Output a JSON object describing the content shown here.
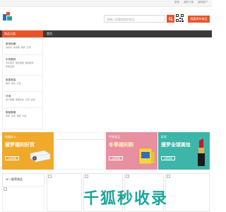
{
  "topbar": {
    "links": [
      "登录",
      "我的订单",
      "我的账户"
    ]
  },
  "header": {
    "search_placeholder": "请输入您要搜索的商品",
    "publish_label": "我要发布商品"
  },
  "nav": {
    "category_label": "商品分类",
    "home_label": "首页"
  },
  "categories": [
    {
      "title": "家用电器",
      "items": "洗衣机  电冰箱  电视  空调"
    },
    {
      "title": "手机数码",
      "items": "手机通讯  摄影摄像  数码配件  智能设备"
    },
    {
      "title": "家居家装",
      "items": "厨具  家纺  灯具"
    },
    {
      "title": "日用",
      "items": "电子电器  美容彩妆  日用  衣物"
    },
    {
      "title": "服装鞋帽",
      "items": "男装  女装  童装  内衣"
    }
  ],
  "promos": [
    {
      "subtitle": "电脑办公",
      "title": "搜罗福利好货",
      "cta": "立即查看",
      "color": "#f0a92a"
    },
    {
      "subtitle": "",
      "title": "",
      "cta": "",
      "color": "#ffffff"
    },
    {
      "subtitle": "牛奶乳品",
      "title": "冬季福利购",
      "cta": "立即查看",
      "color": "#e88fa0"
    },
    {
      "subtitle": "彩妆",
      "title": "搜罗全球美妆",
      "cta": "立即查看",
      "color": "#3db5a8"
    }
  ],
  "products": {
    "section_title": "1F / 推荐商品"
  },
  "watermark": "千狐秒收录",
  "colors": {
    "accent": "#e8542a",
    "nav": "#3a3a3a",
    "watermark": "#1aa59a"
  }
}
